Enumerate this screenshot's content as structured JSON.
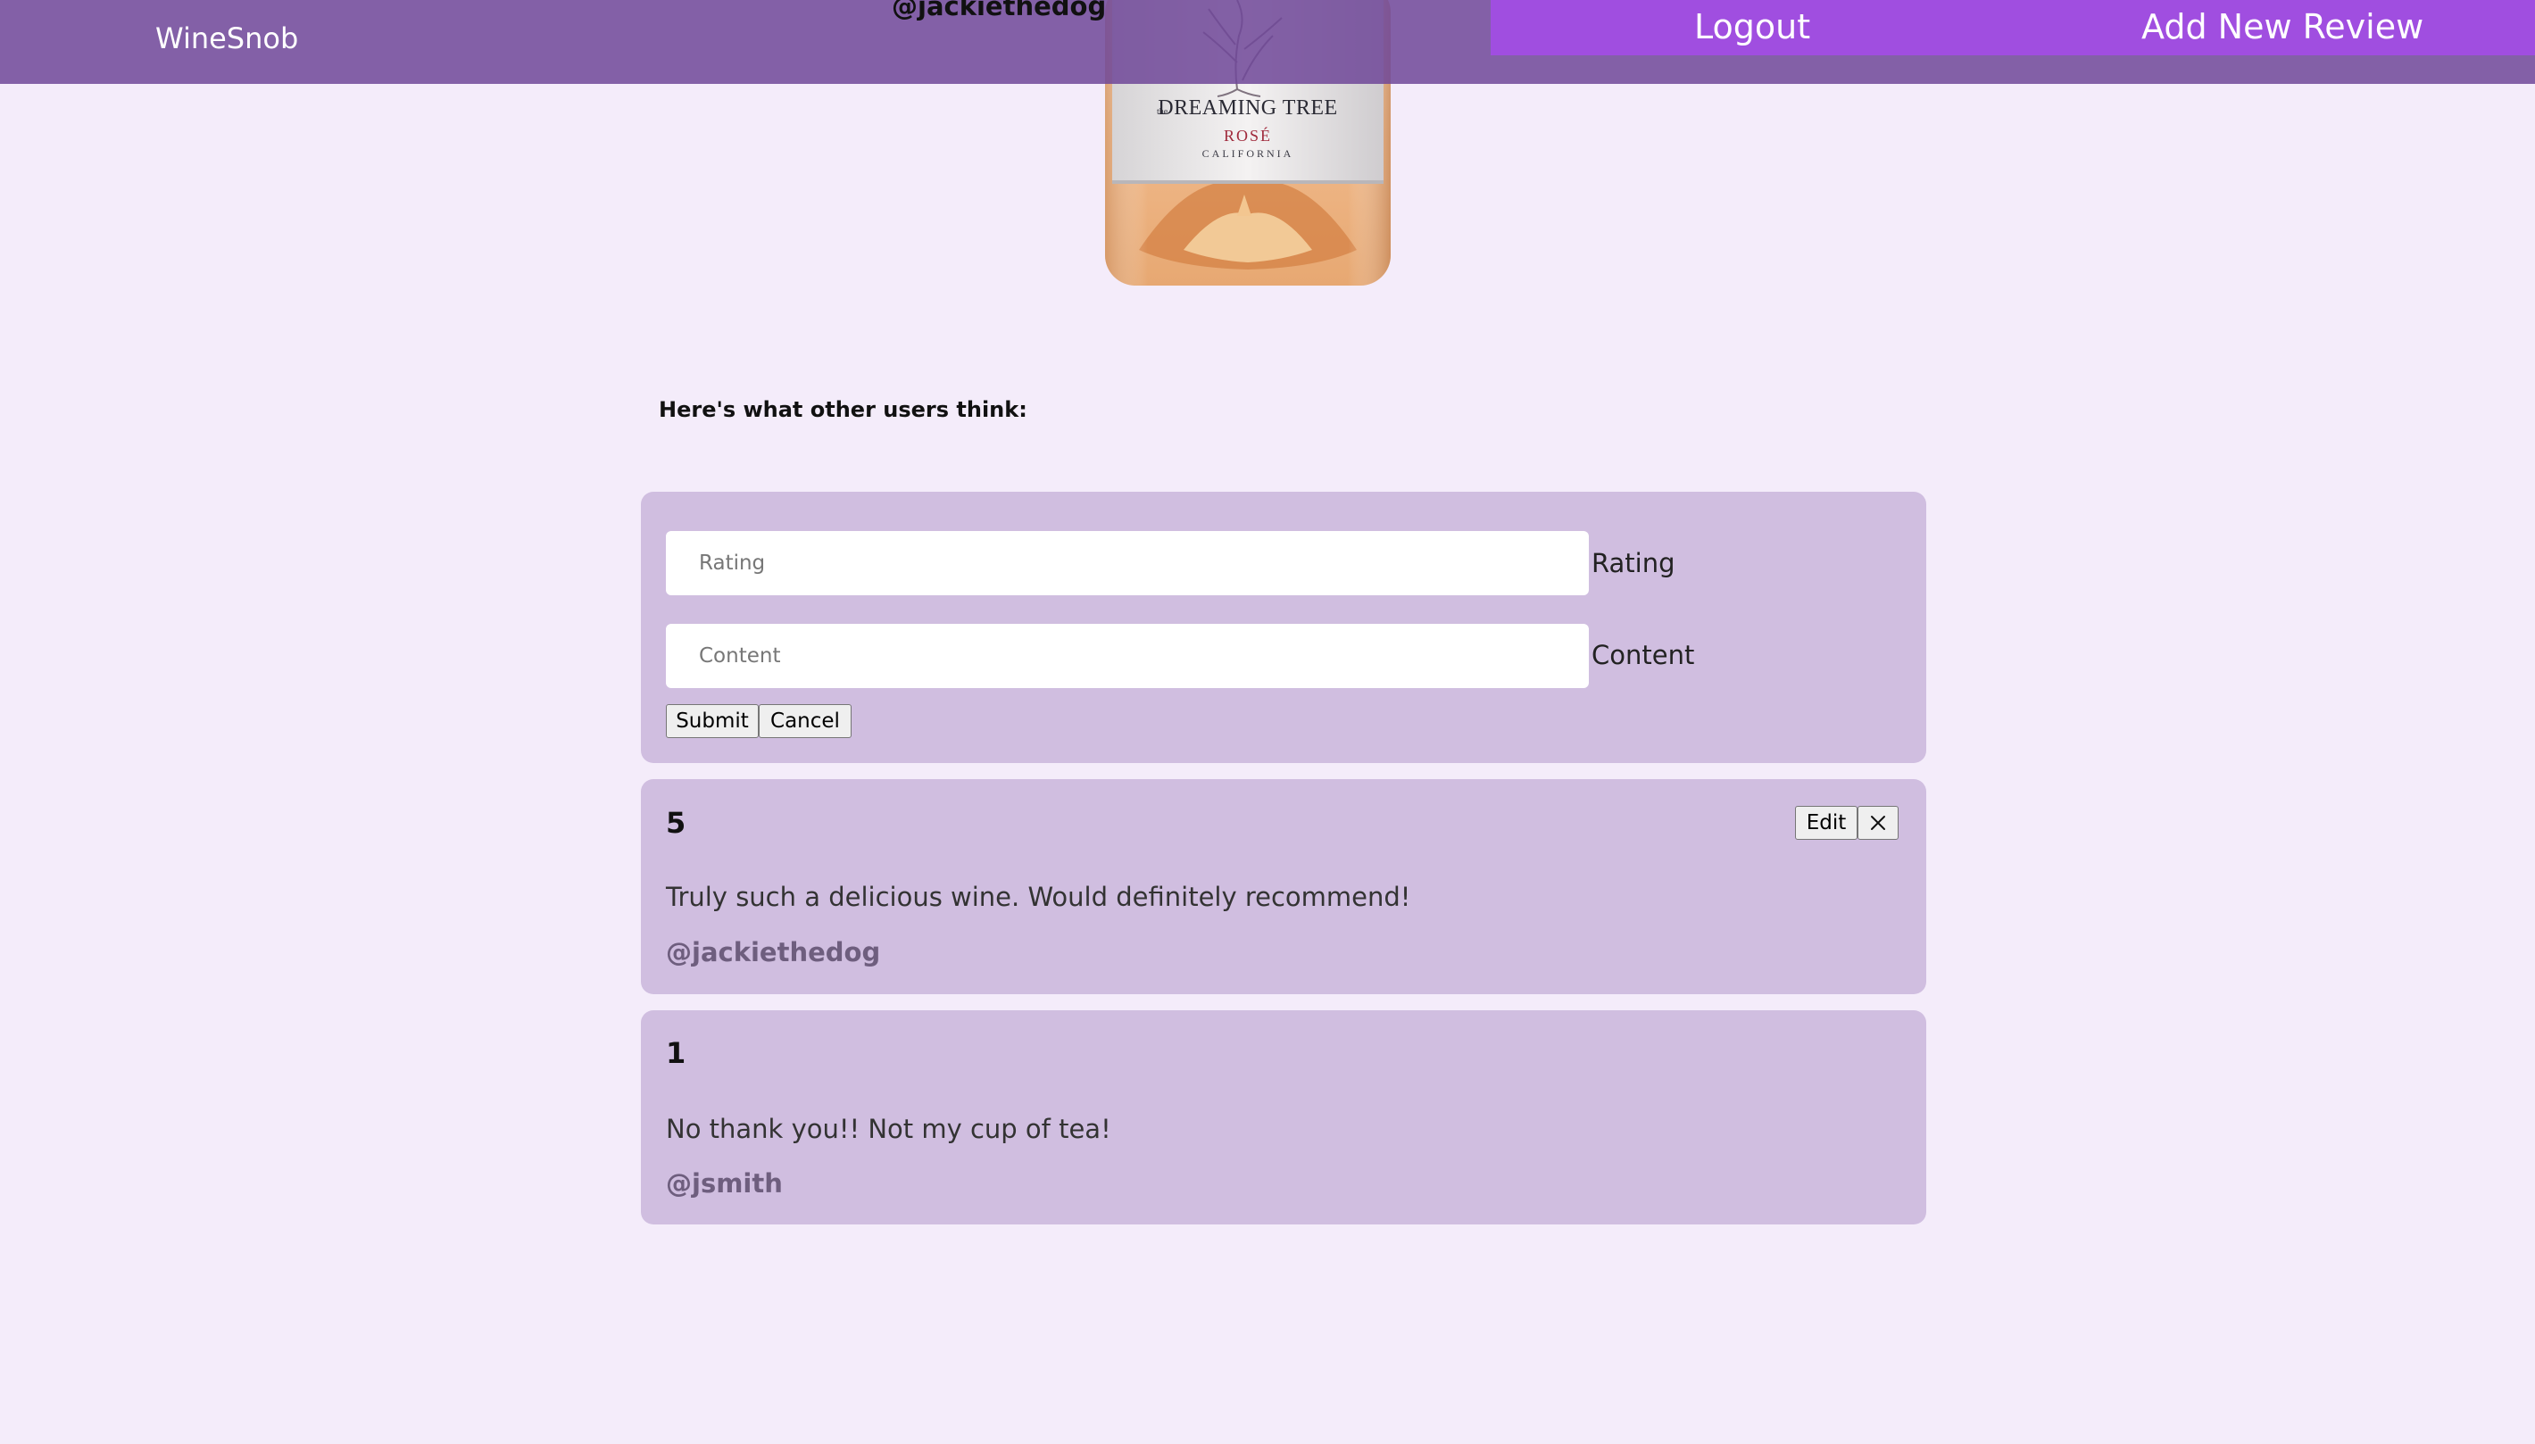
{
  "header": {
    "brand": "WineSnob",
    "username": "@jackiethedog",
    "nav": {
      "logout_label": "Logout",
      "add_review_label": "Add New Review"
    }
  },
  "wine_image": {
    "label_brand_small": "the",
    "label_brand": "DREAMING TREE",
    "label_variety": "ROSÉ",
    "label_region": "CALIFORNIA"
  },
  "reviews_section": {
    "heading": "Here's what other users think:"
  },
  "review_form": {
    "rating_placeholder": "Rating",
    "rating_label": "Rating",
    "content_placeholder": "Content",
    "content_label": "Content",
    "submit_label": "Submit",
    "cancel_label": "Cancel"
  },
  "reviews": [
    {
      "rating": "5",
      "content": "Truly such a delicious wine. Would definitely recommend!",
      "author": "@jackiethedog",
      "edit_label": "Edit",
      "delete_icon": "close-icon"
    },
    {
      "rating": "1",
      "content": "No thank you!! Not my cup of tea!",
      "author": "@jsmith"
    }
  ],
  "colors": {
    "page_background": "#f4ecfa",
    "navbar": "#7c5c9c",
    "nav_actions": "#a04ee0",
    "card": "#d0bee0",
    "author_text": "#6e5e7e"
  }
}
